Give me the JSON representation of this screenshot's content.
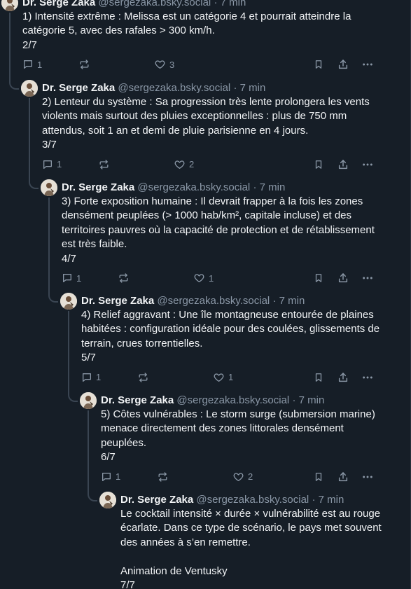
{
  "posts": [
    {
      "name": "Dr. Serge Zaka",
      "handle": "@sergezaka.bsky.social",
      "time": "7 min",
      "lines": [
        "1) Intensité extrême : Melissa est un catégorie 4 et pourrait atteindre la",
        "catégorie 5, avec des rafales > 300 km/h."
      ],
      "counter": "2/7",
      "replies": "1",
      "likes": "3"
    },
    {
      "name": "Dr. Serge Zaka",
      "handle": "@sergezaka.bsky.social",
      "time": "7 min",
      "lines": [
        "2) Lenteur du système : Sa progression très lente prolongera les vents",
        "violents mais surtout des pluies exceptionnelles : plus de 750 mm",
        "attendus, soit 1 an et demi de pluie parisienne en 4 jours."
      ],
      "counter": "3/7",
      "replies": "1",
      "likes": "2"
    },
    {
      "name": "Dr. Serge Zaka",
      "handle": "@sergezaka.bsky.social",
      "time": "7 min",
      "lines": [
        "3) Forte exposition humaine : Il devrait frapper à la fois les zones",
        "densément peuplées (> 1000 hab/km², capitale incluse) et des",
        "territoires pauvres où la capacité de protection et de rétablissement",
        "est très faible."
      ],
      "counter": "4/7",
      "replies": "1",
      "likes": "1"
    },
    {
      "name": "Dr. Serge Zaka",
      "handle": "@sergezaka.bsky.social",
      "time": "7 min",
      "lines": [
        "4) Relief aggravant : Une île montagneuse entourée de plaines",
        "habitées : configuration idéale pour des coulées, glissements de",
        "terrain, crues torrentielles."
      ],
      "counter": "5/7",
      "replies": "1",
      "likes": "1"
    },
    {
      "name": "Dr. Serge Zaka",
      "handle": "@sergezaka.bsky.social",
      "time": "7 min",
      "lines": [
        "5) Côtes vulnérables : Le storm surge (submersion marine)",
        "menace directement des zones littorales densément",
        "peuplées."
      ],
      "counter": "6/7",
      "replies": "1",
      "likes": "2"
    },
    {
      "name": "Dr. Serge Zaka",
      "handle": "@sergezaka.bsky.social",
      "time": "7 min",
      "lines": [
        "Le cocktail intensité × durée × vulnérabilité est au rouge",
        "écarlate. Dans ce type de scénario, le pays met souvent",
        "des années à s’en remettre.",
        "",
        "Animation de Ventusky"
      ],
      "counter": "7/7",
      "replies": "",
      "likes": ""
    }
  ],
  "ui": {
    "dot": "·"
  },
  "icons": [
    "reply-icon",
    "repost-icon",
    "like-icon",
    "bookmark-icon",
    "share-icon",
    "more-icon"
  ]
}
